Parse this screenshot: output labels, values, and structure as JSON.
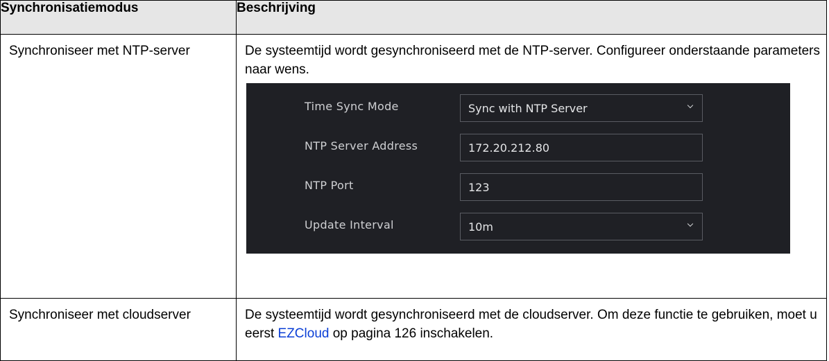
{
  "table": {
    "headers": [
      "Synchronisatiemodus",
      "Beschrijving"
    ],
    "rows": [
      {
        "mode": "Synchroniseer met NTP-server",
        "description": "De systeemtijd wordt gesynchroniseerd met de NTP-server. Configureer onderstaande parameters naar wens."
      },
      {
        "mode": "Synchroniseer met cloudserver",
        "description_before": "De systeemtijd wordt gesynchroniseerd met de cloudserver. Om deze functie te gebruiken, moet u eerst ",
        "link_text": "EZCloud",
        "description_after": " op pagina 126 inschakelen."
      }
    ]
  },
  "device_panel": {
    "time_sync_mode": {
      "label": "Time Sync Mode",
      "value": "Sync with NTP Server"
    },
    "ntp_server_address": {
      "label": "NTP Server Address",
      "value": "172.20.212.80"
    },
    "ntp_port": {
      "label": "NTP Port",
      "value": "123"
    },
    "update_interval": {
      "label": "Update Interval",
      "value": "10m"
    }
  }
}
